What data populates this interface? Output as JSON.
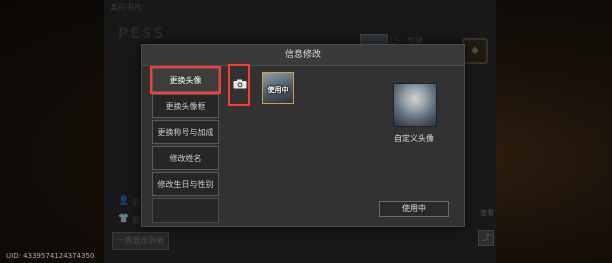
{
  "background": {
    "header": "某的书片",
    "player_name": "PESS",
    "rank_text": "L5 · 铁骑",
    "badge": "◆",
    "rows": [
      "名片印",
      "展示设置"
    ],
    "bottom_button": "一直显示到者",
    "timestamp": "UID: 4339574124374350",
    "side_text": "查看"
  },
  "dialog": {
    "title": "信息修改",
    "menu": [
      {
        "label": "更换头像",
        "active": true
      },
      {
        "label": "更换头像框",
        "active": false
      },
      {
        "label": "更换称号与加成",
        "active": false
      },
      {
        "label": "修改姓名",
        "active": false
      },
      {
        "label": "修改生日与性别",
        "active": false
      }
    ],
    "camera_icon": "camera-icon",
    "thumb_label": "使用中",
    "custom_label": "自定义头像",
    "use_button": "使用中"
  },
  "colors": {
    "highlight": "#ff3b30",
    "thumb_border": "#d99a3a"
  }
}
